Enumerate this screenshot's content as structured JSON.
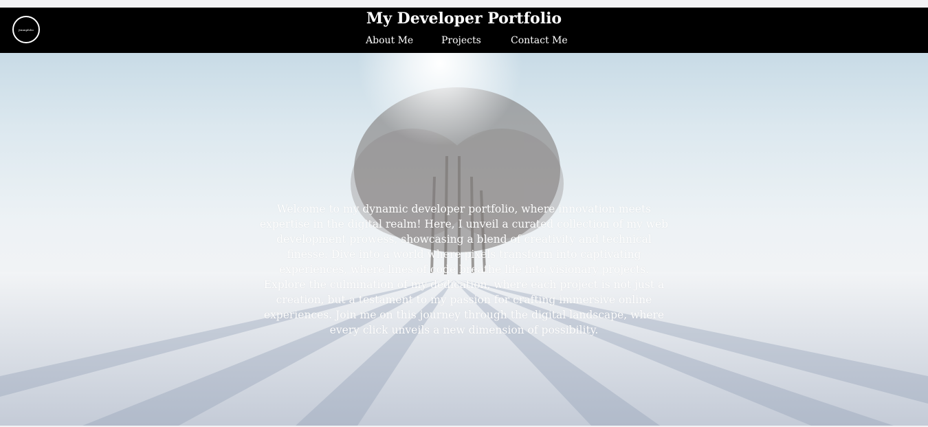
{
  "header": {
    "title": "My Developer Portfolio",
    "logo_text": "jtmmpfolio",
    "nav": [
      {
        "label": "About Me"
      },
      {
        "label": "Projects"
      },
      {
        "label": "Contact Me"
      }
    ]
  },
  "hero": {
    "background_image": "snowy-landscape-tree",
    "intro_text": "Welcome to my dynamic developer portfolio, where innovation meets expertise in the digital realm! Here, I unveil a curated collection of my web development prowess, showcasing a blend of creativity and technical finesse. Dive into a world where pixels transform into captivating experiences, where lines of code breathe life into visionary projects. Explore the culmination of my dedication, where each project is not just a creation, but a testament to my passion for crafting immersive online experiences. Join me on this journey through the digital landscape, where every click unveils a new dimension of possibility."
  },
  "colors": {
    "header_bg": "#000000",
    "header_text": "#ffffff",
    "page_bg": "#f3f3f5"
  }
}
